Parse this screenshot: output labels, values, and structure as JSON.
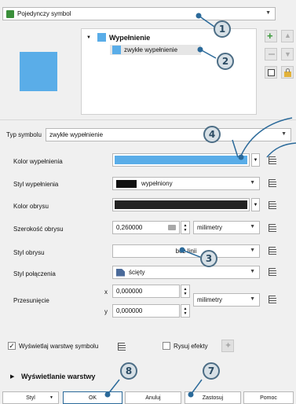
{
  "header": {
    "renderer": "Pojedynczy symbol"
  },
  "layer_tree": {
    "root": "Wypełnienie",
    "child": "zwykłe wypełnienie"
  },
  "symbol_type": {
    "label": "Typ symbolu",
    "value": "zwykłe wypełnienie"
  },
  "fill_color": {
    "label": "Kolor wypełnienia",
    "color": "#5aade8"
  },
  "fill_style": {
    "label": "Styl wypełnienia",
    "value": "wypełniony"
  },
  "stroke_color": {
    "label": "Kolor obrysu",
    "color": "#232323"
  },
  "stroke_width": {
    "label": "Szerokość obrysu",
    "value": "0,260000",
    "unit": "milimetry"
  },
  "stroke_style": {
    "label": "Styl obrysu",
    "value": "bez linii"
  },
  "join_style": {
    "label": "Styl połączenia",
    "value": "ścięty"
  },
  "offset": {
    "label": "Przesunięcie",
    "x_label": "x",
    "x": "0,000000",
    "y_label": "y",
    "y": "0,000000",
    "unit": "milimetry"
  },
  "options": {
    "show_layer_symbol": "Wyświetlaj warstwę symbolu",
    "draw_effects": "Rysuj efekty"
  },
  "section": {
    "layer_display": "Wyświetlanie warstwy"
  },
  "buttons": {
    "style": "Styl",
    "ok": "OK",
    "cancel": "Anuluj",
    "apply": "Zastosuj",
    "help": "Pomoc"
  },
  "callouts": [
    "1",
    "2",
    "3",
    "4",
    "7",
    "8"
  ],
  "colors": {
    "accent": "#2b6a9a",
    "swatch_preview": "#5aade8"
  }
}
